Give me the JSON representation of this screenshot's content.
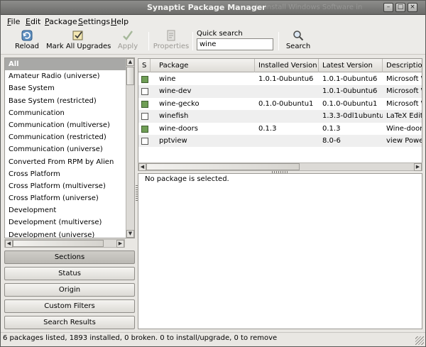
{
  "window": {
    "title": "Synaptic Package Manager",
    "title_ghost": "- to install Windows Software in"
  },
  "menu": {
    "file_ul": "F",
    "file_rest": "ile",
    "edit_ul": "E",
    "edit_rest": "dit",
    "package_ul": "P",
    "package_rest": "ackage",
    "settings_ul": "S",
    "settings_rest": "ettings",
    "help_ul": "H",
    "help_rest": "elp"
  },
  "toolbar": {
    "reload": "Reload",
    "mark_all_upgrades": "Mark All Upgrades",
    "apply": "Apply",
    "properties": "Properties",
    "quick_search_label": "Quick search",
    "quick_search_value": "wine",
    "search": "Search"
  },
  "sections": [
    "All",
    "Amateur Radio (universe)",
    "Base System",
    "Base System (restricted)",
    "Communication",
    "Communication (multiverse)",
    "Communication (restricted)",
    "Communication (universe)",
    "Converted From RPM by Alien",
    "Cross Platform",
    "Cross Platform (multiverse)",
    "Cross Platform (universe)",
    "Development",
    "Development (multiverse)",
    "Development (universe)"
  ],
  "filters": {
    "sections": "Sections",
    "status": "Status",
    "origin": "Origin",
    "custom_filters": "Custom Filters",
    "search_results": "Search Results"
  },
  "table": {
    "columns": {
      "s": "S",
      "package": "Package",
      "installed": "Installed Version",
      "latest": "Latest Version",
      "description": "Description"
    },
    "rows": [
      {
        "package": "wine",
        "installed": "1.0.1-0ubuntu6",
        "latest": "1.0.1-0ubuntu6",
        "description": "Microsoft Windows Compatibility Layer",
        "status": "installed"
      },
      {
        "package": "wine-dev",
        "installed": "",
        "latest": "1.0.1-0ubuntu6",
        "description": "Microsoft Windows Compatibility Layer",
        "status": "available"
      },
      {
        "package": "wine-gecko",
        "installed": "0.1.0-0ubuntu1",
        "latest": "0.1.0-0ubuntu1",
        "description": "Microsoft Windows Compatibility Layer",
        "status": "installed"
      },
      {
        "package": "winefish",
        "installed": "",
        "latest": "1.3.3-0dl1ubuntu1",
        "description": "LaTeX Editor",
        "status": "available"
      },
      {
        "package": "wine-doors",
        "installed": "0.1.3",
        "latest": "0.1.3",
        "description": "Wine-doors",
        "status": "installed"
      },
      {
        "package": "pptview",
        "installed": "",
        "latest": "8.0-6",
        "description": "view PowerPoint",
        "status": "available"
      }
    ]
  },
  "details": {
    "text": "No package is selected."
  },
  "statusbar": {
    "text": "6 packages listed, 1893 installed, 0 broken. 0 to install/upgrade, 0 to remove"
  },
  "colors": {
    "installed_box": "#6f9e55",
    "selection": "#a8a8a6"
  }
}
